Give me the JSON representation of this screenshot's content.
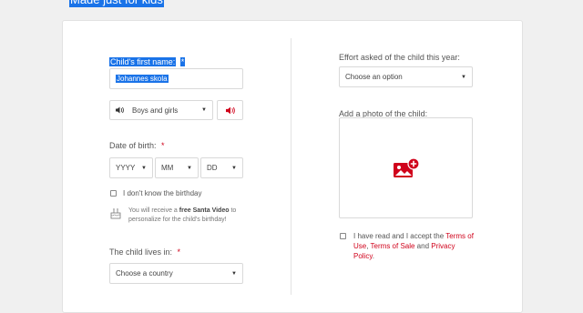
{
  "header": {
    "tagline": "Made just for kids"
  },
  "left": {
    "first_name_label": "Child's first name:",
    "first_name_req": "*",
    "first_name_value": "Johannes skola",
    "voice_select": "Boys and girls",
    "dob_label": "Date of birth:",
    "dob_req": "*",
    "dob_year": "YYYY",
    "dob_month": "MM",
    "dob_day": "DD",
    "unknown_birthday": "I don't know the birthday",
    "info_pre": "You will receive a ",
    "info_bold": "free Santa Video",
    "info_post": " to personalize for the child's birthday!",
    "lives_label": "The child lives in:",
    "lives_req": "*",
    "country_select": "Choose a country"
  },
  "right": {
    "effort_label": "Effort asked of the child this year:",
    "effort_select": "Choose an option",
    "photo_label": "Add a photo of the child:",
    "terms_pre": "I have read and I accept the ",
    "terms_link1": "Terms of Use",
    "terms_comma": ", ",
    "terms_link2": "Terms of Sale",
    "terms_and": " and ",
    "terms_link3": "Privacy Policy",
    "terms_end": "."
  }
}
